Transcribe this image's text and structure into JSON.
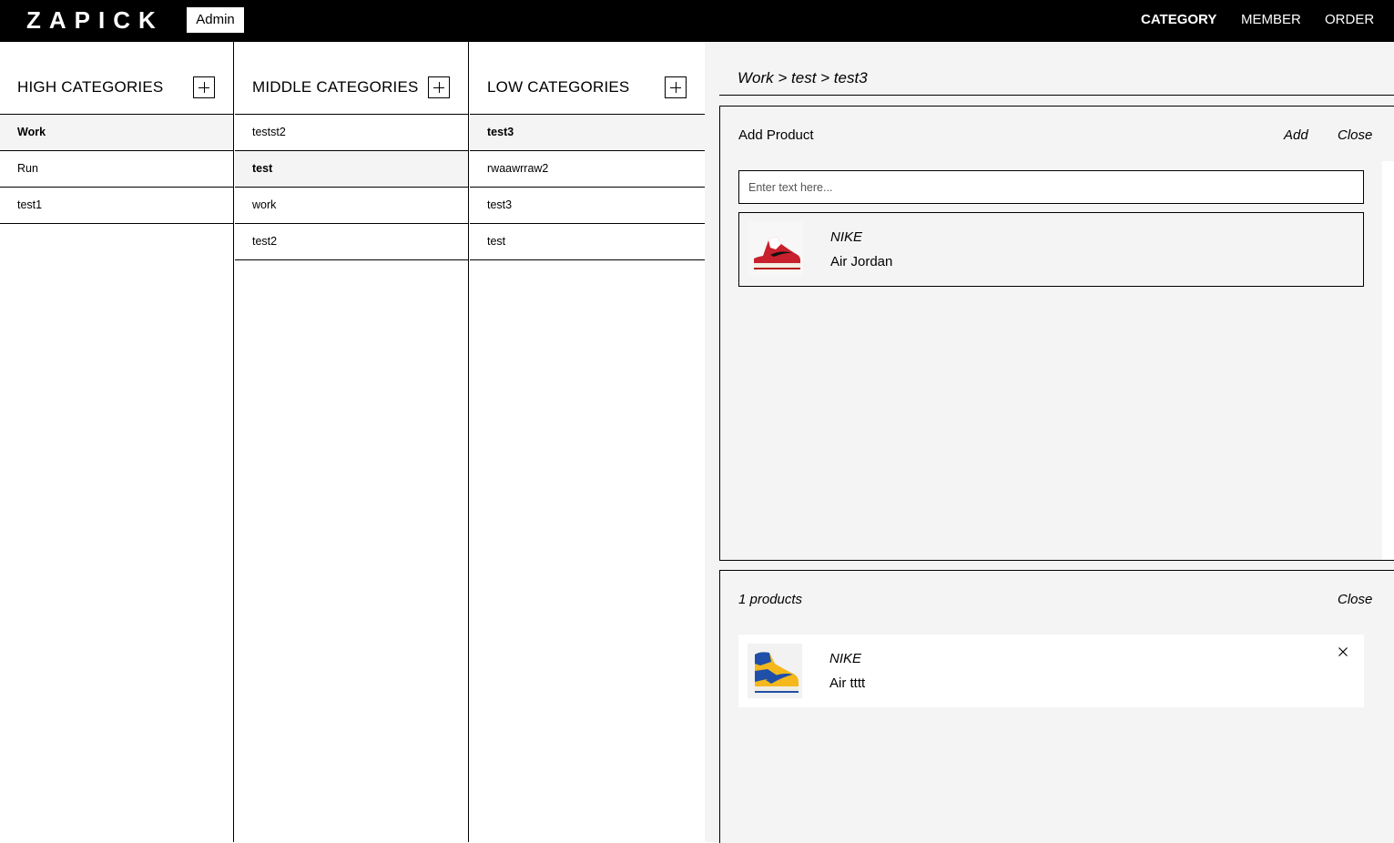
{
  "header": {
    "logo": "ZAPICK",
    "badge": "Admin",
    "nav": [
      "CATEGORY",
      "MEMBER",
      "ORDER"
    ],
    "active_nav": "CATEGORY"
  },
  "columns": [
    {
      "title": "HIGH CATEGORIES",
      "items": [
        "Work",
        "Run",
        "test1"
      ],
      "selected": "Work"
    },
    {
      "title": "MIDDLE CATEGORIES",
      "items": [
        "testst2",
        "test",
        "work",
        "test2"
      ],
      "selected": "test"
    },
    {
      "title": "LOW CATEGORIES",
      "items": [
        "test3",
        "rwaawrraw2",
        "test3",
        "test"
      ],
      "selected": "test3"
    }
  ],
  "breadcrumb": "Work > test > test3",
  "add_panel": {
    "title": "Add Product",
    "add_label": "Add",
    "close_label": "Close",
    "search_placeholder": "Enter text here...",
    "search_value": "",
    "result": {
      "brand": "NIKE",
      "name": "Air Jordan",
      "image": "red-sneaker"
    }
  },
  "list_panel": {
    "count_label": "1 products",
    "close_label": "Close",
    "products": [
      {
        "brand": "NIKE",
        "name": "Air tttt",
        "image": "blue-yellow-sneaker"
      }
    ]
  },
  "colors": {
    "header_bg": "#000000",
    "panel_bg": "#f4f4f4",
    "selected_row": "#f4f4f4"
  }
}
